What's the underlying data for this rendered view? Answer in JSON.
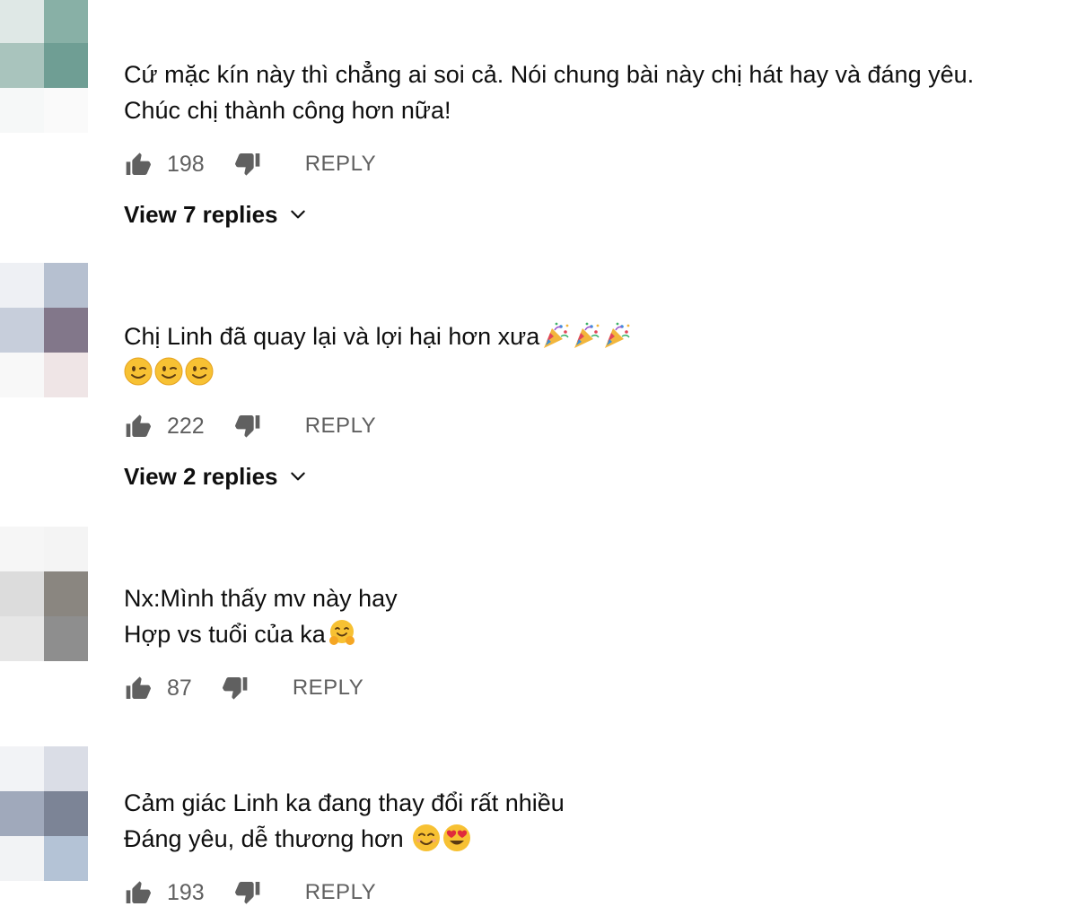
{
  "colors": {
    "text_primary": "#0f0f0f",
    "text_secondary": "#606060",
    "icon_gray": "#606060",
    "icon_dark": "#0f0f0f"
  },
  "icons": {
    "like": "thumbs-up-icon",
    "dislike": "thumbs-down-icon",
    "expand": "chevron-down-icon",
    "party": "party-popper-emoji",
    "wink": "winking-face-emoji",
    "hug": "hugging-face-emoji",
    "smile": "smiling-face-emoji",
    "heart_eyes": "heart-eyes-emoji"
  },
  "comments": [
    {
      "lines": [
        "Cứ mặc kín này thì chẳng ai soi cả. Nói chung bài này chị hát hay và đáng yêu.",
        "Chúc chị thành công hơn nữa!"
      ],
      "likes": "198",
      "reply_label": "REPLY",
      "view_replies": "View 7 replies"
    },
    {
      "lines": [
        "Chị Linh đã quay lại và lợi hại hơn xưa",
        ""
      ],
      "likes": "222",
      "reply_label": "REPLY",
      "view_replies": "View 2 replies"
    },
    {
      "lines": [
        "Nx:Mình thấy mv này hay",
        "Hợp vs tuổi của ka"
      ],
      "likes": "87",
      "reply_label": "REPLY"
    },
    {
      "lines": [
        "Cảm giác Linh ka đang thay đổi rất nhiều",
        "Đáng yêu, dễ thương hơn "
      ],
      "likes": "193",
      "reply_label": "REPLY"
    }
  ]
}
